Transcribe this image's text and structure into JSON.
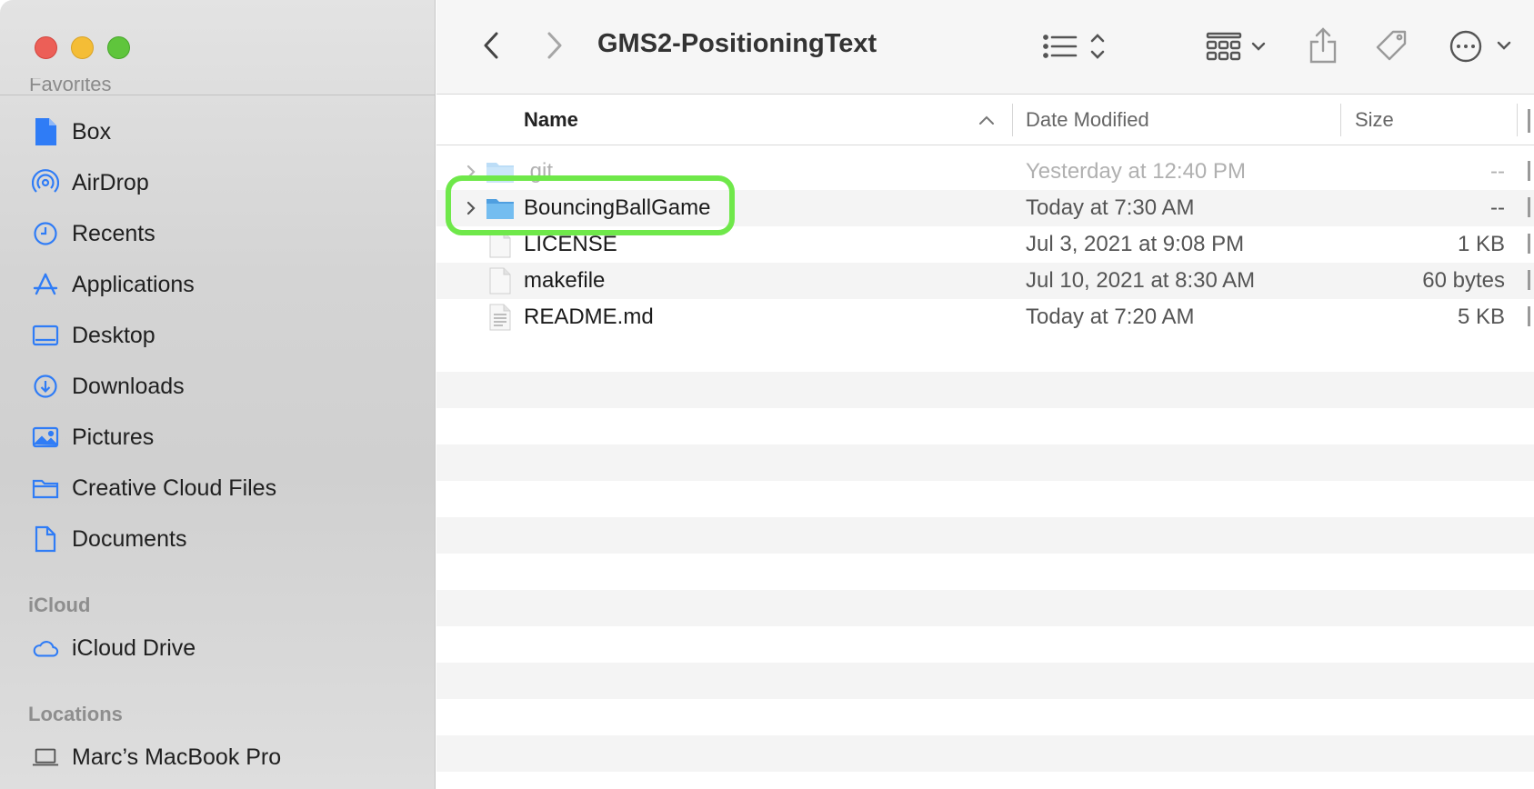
{
  "window": {
    "title": "GMS2-PositioningText"
  },
  "sidebar": {
    "favorites_label_partial": "Favorites",
    "favorites": [
      {
        "label": "Box",
        "icon": "box-doc-icon"
      },
      {
        "label": "AirDrop",
        "icon": "airdrop-icon"
      },
      {
        "label": "Recents",
        "icon": "clock-icon"
      },
      {
        "label": "Applications",
        "icon": "applications-icon"
      },
      {
        "label": "Desktop",
        "icon": "desktop-icon"
      },
      {
        "label": "Downloads",
        "icon": "download-icon"
      },
      {
        "label": "Pictures",
        "icon": "pictures-icon"
      },
      {
        "label": "Creative Cloud Files",
        "icon": "folder-icon"
      },
      {
        "label": "Documents",
        "icon": "document-icon"
      }
    ],
    "icloud_heading": "iCloud",
    "icloud": [
      {
        "label": "iCloud Drive",
        "icon": "cloud-icon"
      }
    ],
    "locations_heading": "Locations",
    "locations": [
      {
        "label": "Marc’s MacBook Pro",
        "icon": "laptop-icon"
      }
    ]
  },
  "toolbar": {
    "back": "back-chevron-icon",
    "forward": "forward-chevron-icon",
    "view": "list-view-icon",
    "group": "group-grid-icon",
    "share": "share-icon",
    "tag": "tag-icon",
    "more": "more-ellipsis-icon"
  },
  "columns": {
    "name": "Name",
    "date": "Date Modified",
    "size": "Size"
  },
  "files": [
    {
      "name": ".git",
      "date": "Yesterday at 12:40 PM",
      "size": "--",
      "type": "folder",
      "dimmed": true
    },
    {
      "name": "BouncingBallGame",
      "date": "Today at 7:30 AM",
      "size": "--",
      "type": "folder",
      "highlighted": true
    },
    {
      "name": "LICENSE",
      "date": "Jul 3, 2021 at 9:08 PM",
      "size": "1 KB",
      "type": "file"
    },
    {
      "name": "makefile",
      "date": "Jul 10, 2021 at 8:30 AM",
      "size": "60 bytes",
      "type": "file"
    },
    {
      "name": "README.md",
      "date": "Today at 7:20 AM",
      "size": "5 KB",
      "type": "text-file"
    }
  ],
  "colors": {
    "accent_blue": "#2f7cf6",
    "highlight_green": "#6fe84a",
    "folder_blue": "#6cb6ee"
  }
}
